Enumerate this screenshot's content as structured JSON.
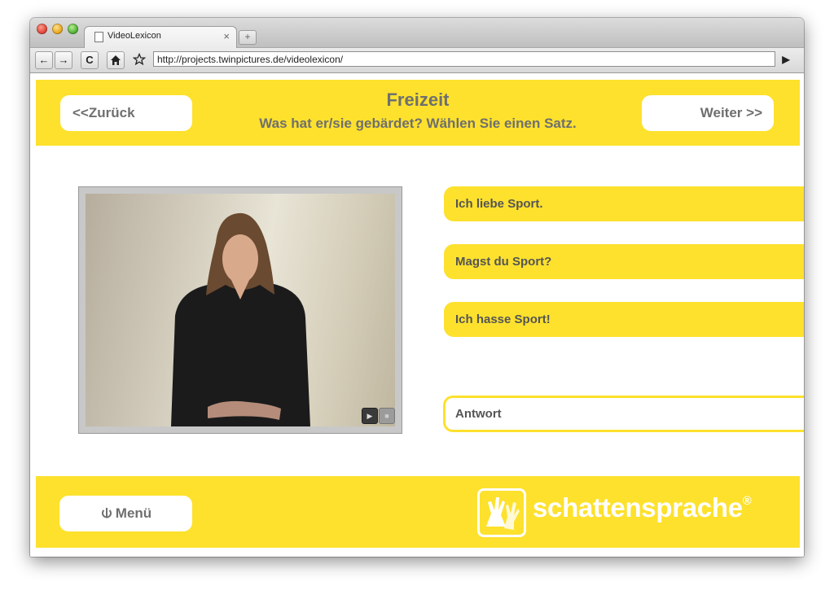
{
  "browser": {
    "tab_title": "VideoLexicon",
    "tab_close": "×",
    "new_tab": "+",
    "nav": {
      "back": "←",
      "forward": "→",
      "reload": "C"
    },
    "url": "http://projects.twinpictures.de/videolexicon/",
    "go": "▶"
  },
  "header": {
    "back_label": "<<Zurück",
    "title": "Freizeit",
    "subtitle": "Was hat er/sie gebärdet?  Wählen Sie einen Satz.",
    "next_label": "Weiter >>"
  },
  "video": {
    "play_icon": "▶",
    "stop_icon": "■"
  },
  "options": [
    {
      "label": "Ich liebe Sport."
    },
    {
      "label": "Magst du Sport?"
    },
    {
      "label": "Ich hasse Sport!"
    }
  ],
  "answer": {
    "label": "Antwort"
  },
  "footer": {
    "menu_label": "Menü",
    "brand": "schattensprache",
    "trademark": "®"
  },
  "colors": {
    "accent_yellow": "#fde12d",
    "text_gray": "#6f6f6f"
  }
}
